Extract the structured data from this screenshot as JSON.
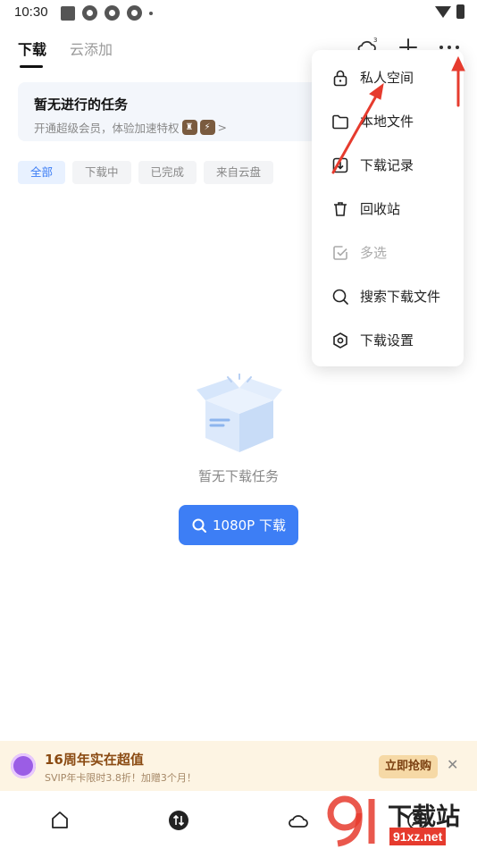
{
  "status_bar": {
    "time": "10:30"
  },
  "tabs": [
    {
      "label": "下载",
      "active": true
    },
    {
      "label": "云添加",
      "active": false
    }
  ],
  "cloud_badge": "3",
  "banner": {
    "title": "暂无进行的任务",
    "subtitle": "开通超级会员，体验加速特权",
    "chevron": ">"
  },
  "filters": [
    {
      "label": "全部",
      "active": true
    },
    {
      "label": "下载中",
      "active": false
    },
    {
      "label": "已完成",
      "active": false
    },
    {
      "label": "来自云盘",
      "active": false
    }
  ],
  "empty_state": {
    "text": "暂无下载任务"
  },
  "download_button": {
    "label": "1080P 下载"
  },
  "menu": {
    "items": [
      {
        "label": "私人空间",
        "icon": "lock-icon",
        "disabled": false
      },
      {
        "label": "本地文件",
        "icon": "folder-icon",
        "disabled": false
      },
      {
        "label": "下载记录",
        "icon": "download-record-icon",
        "disabled": false
      },
      {
        "label": "回收站",
        "icon": "trash-icon",
        "disabled": false
      },
      {
        "label": "多选",
        "icon": "checkbox-icon",
        "disabled": true
      },
      {
        "label": "搜索下载文件",
        "icon": "search-icon",
        "disabled": false
      },
      {
        "label": "下载设置",
        "icon": "settings-icon",
        "disabled": false
      }
    ]
  },
  "promo": {
    "title": "16周年实在超值",
    "subtitle": "SVIP年卡限时3.8折！加赠3个月！",
    "button": "立即抢购",
    "close": "✕"
  },
  "watermark": {
    "text": "下载站",
    "url": "91xz.net"
  },
  "colors": {
    "accent": "#3d7ef5",
    "annotation": "#e63b2e",
    "promo_bg": "#fdf4e3"
  }
}
